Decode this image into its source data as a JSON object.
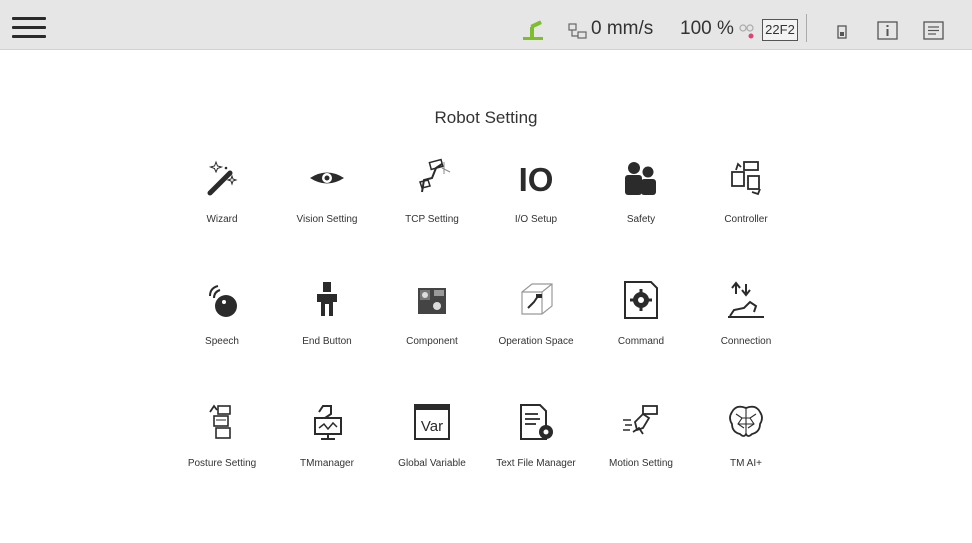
{
  "header": {
    "speed_label": "0 mm/s",
    "percent_label": "100 %",
    "badge": "22F2",
    "accent_color": "#7cbf2b"
  },
  "page": {
    "title": "Robot Setting"
  },
  "tiles": [
    {
      "label": "Wizard",
      "icon": "wizard-icon"
    },
    {
      "label": "Vision Setting",
      "icon": "eye-icon"
    },
    {
      "label": "TCP Setting",
      "icon": "tcp-icon"
    },
    {
      "label": "I/O Setup",
      "icon": "io-icon"
    },
    {
      "label": "Safety",
      "icon": "safety-icon"
    },
    {
      "label": "Controller",
      "icon": "controller-icon"
    },
    {
      "label": "Speech",
      "icon": "speech-icon"
    },
    {
      "label": "End Button",
      "icon": "end-button-icon"
    },
    {
      "label": "Component",
      "icon": "component-icon"
    },
    {
      "label": "Operation Space",
      "icon": "operation-space-icon"
    },
    {
      "label": "Command",
      "icon": "command-icon"
    },
    {
      "label": "Connection",
      "icon": "connection-icon"
    },
    {
      "label": "Posture Setting",
      "icon": "posture-icon"
    },
    {
      "label": "TMmanager",
      "icon": "tmmanager-icon"
    },
    {
      "label": "Global Variable",
      "icon": "var-icon"
    },
    {
      "label": "Text File Manager",
      "icon": "text-file-icon"
    },
    {
      "label": "Motion Setting",
      "icon": "motion-icon"
    },
    {
      "label": "TM AI+",
      "icon": "brain-icon"
    }
  ],
  "io_icon_text": "IO",
  "var_icon_text": "Var"
}
